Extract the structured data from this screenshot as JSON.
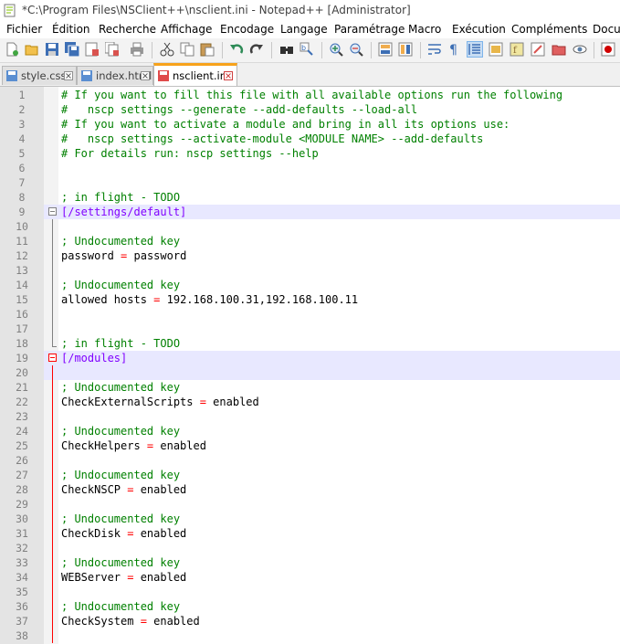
{
  "window": {
    "title": "*C:\\Program Files\\NSClient++\\nsclient.ini - Notepad++ [Administrator]"
  },
  "menu": [
    "Fichier",
    "Édition",
    "Recherche",
    "Affichage",
    "Encodage",
    "Langage",
    "Paramétrage",
    "Macro",
    "Exécution",
    "Compléments",
    "Docu"
  ],
  "toolbar_icons": [
    "new-file-icon",
    "open-file-icon",
    "save-icon",
    "save-all-icon",
    "close-icon",
    "close-all-icon",
    "print-icon",
    "cut-icon",
    "copy-icon",
    "paste-icon",
    "undo-icon",
    "redo-icon",
    "find-icon",
    "replace-icon",
    "zoom-in-icon",
    "zoom-out-icon",
    "sync-vertical-icon",
    "sync-horizontal-icon",
    "word-wrap-icon",
    "show-all-chars-icon",
    "indent-guide-icon",
    "doc-map-icon",
    "function-list-icon",
    "folder-workspace-icon",
    "monitoring-icon",
    "eye-icon",
    "record-macro-icon"
  ],
  "tabs": [
    {
      "label": "style.css",
      "active": false,
      "color": "#5a8ed1"
    },
    {
      "label": "index.html",
      "active": false,
      "color": "#5a8ed1"
    },
    {
      "label": "nsclient.ini",
      "active": true,
      "color": "#e04b4b"
    }
  ],
  "colors": {
    "comment": "#008000",
    "section": "#8000ff",
    "operator": "#ff0000",
    "text": "#000000",
    "line_number": "#808080",
    "current_line": "#e8e8ff",
    "fold_red": "#ff0000"
  },
  "lines": [
    {
      "n": "1",
      "segs": [
        {
          "t": "# If you want to fill this file with all available options run the following",
          "c": "comment"
        }
      ]
    },
    {
      "n": "2",
      "segs": [
        {
          "t": "#   nscp settings --generate --add-defaults --load-all",
          "c": "comment"
        }
      ]
    },
    {
      "n": "3",
      "segs": [
        {
          "t": "# If you want to activate a module and bring in all its options use:",
          "c": "comment"
        }
      ]
    },
    {
      "n": "4",
      "segs": [
        {
          "t": "#   nscp settings --activate-module <MODULE NAME> --add-defaults",
          "c": "comment"
        }
      ]
    },
    {
      "n": "5",
      "segs": [
        {
          "t": "# For details run: nscp settings --help",
          "c": "comment"
        }
      ]
    },
    {
      "n": "6",
      "segs": []
    },
    {
      "n": "7",
      "segs": []
    },
    {
      "n": "8",
      "segs": [
        {
          "t": "; in flight - TODO",
          "c": "comment"
        }
      ]
    },
    {
      "n": "9",
      "segs": [
        {
          "t": "[/settings/default]",
          "c": "section"
        }
      ],
      "hl": true,
      "fold": "box-gray"
    },
    {
      "n": "10",
      "segs": []
    },
    {
      "n": "11",
      "segs": [
        {
          "t": "; Undocumented key",
          "c": "comment"
        }
      ]
    },
    {
      "n": "12",
      "segs": [
        {
          "t": "password ",
          "c": "text"
        },
        {
          "t": "=",
          "c": "operator"
        },
        {
          "t": " password",
          "c": "text"
        }
      ]
    },
    {
      "n": "13",
      "segs": []
    },
    {
      "n": "14",
      "segs": [
        {
          "t": "; Undocumented key",
          "c": "comment"
        }
      ]
    },
    {
      "n": "15",
      "segs": [
        {
          "t": "allowed hosts ",
          "c": "text"
        },
        {
          "t": "=",
          "c": "operator"
        },
        {
          "t": " 192.168.100.31,192.168.100.11",
          "c": "text"
        }
      ]
    },
    {
      "n": "16",
      "segs": []
    },
    {
      "n": "17",
      "segs": []
    },
    {
      "n": "18",
      "segs": [
        {
          "t": "; in flight - TODO",
          "c": "comment"
        }
      ]
    },
    {
      "n": "19",
      "segs": [
        {
          "t": "[/modules]",
          "c": "section"
        }
      ],
      "hl": true,
      "fold": "box-red"
    },
    {
      "n": "20",
      "segs": [],
      "hl": true
    },
    {
      "n": "21",
      "segs": [
        {
          "t": "; Undocumented key",
          "c": "comment"
        }
      ]
    },
    {
      "n": "22",
      "segs": [
        {
          "t": "CheckExternalScripts ",
          "c": "text"
        },
        {
          "t": "=",
          "c": "operator"
        },
        {
          "t": " enabled",
          "c": "text"
        }
      ]
    },
    {
      "n": "23",
      "segs": []
    },
    {
      "n": "24",
      "segs": [
        {
          "t": "; Undocumented key",
          "c": "comment"
        }
      ]
    },
    {
      "n": "25",
      "segs": [
        {
          "t": "CheckHelpers ",
          "c": "text"
        },
        {
          "t": "=",
          "c": "operator"
        },
        {
          "t": " enabled",
          "c": "text"
        }
      ]
    },
    {
      "n": "26",
      "segs": []
    },
    {
      "n": "27",
      "segs": [
        {
          "t": "; Undocumented key",
          "c": "comment"
        }
      ]
    },
    {
      "n": "28",
      "segs": [
        {
          "t": "CheckNSCP ",
          "c": "text"
        },
        {
          "t": "=",
          "c": "operator"
        },
        {
          "t": " enabled",
          "c": "text"
        }
      ]
    },
    {
      "n": "29",
      "segs": []
    },
    {
      "n": "30",
      "segs": [
        {
          "t": "; Undocumented key",
          "c": "comment"
        }
      ]
    },
    {
      "n": "31",
      "segs": [
        {
          "t": "CheckDisk ",
          "c": "text"
        },
        {
          "t": "=",
          "c": "operator"
        },
        {
          "t": " enabled",
          "c": "text"
        }
      ]
    },
    {
      "n": "32",
      "segs": []
    },
    {
      "n": "33",
      "segs": [
        {
          "t": "; Undocumented key",
          "c": "comment"
        }
      ]
    },
    {
      "n": "34",
      "segs": [
        {
          "t": "WEBServer ",
          "c": "text"
        },
        {
          "t": "=",
          "c": "operator"
        },
        {
          "t": " enabled",
          "c": "text"
        }
      ]
    },
    {
      "n": "35",
      "segs": []
    },
    {
      "n": "36",
      "segs": [
        {
          "t": "; Undocumented key",
          "c": "comment"
        }
      ]
    },
    {
      "n": "37",
      "segs": [
        {
          "t": "CheckSystem ",
          "c": "text"
        },
        {
          "t": "=",
          "c": "operator"
        },
        {
          "t": " enabled",
          "c": "text"
        }
      ]
    },
    {
      "n": "38",
      "segs": []
    }
  ]
}
